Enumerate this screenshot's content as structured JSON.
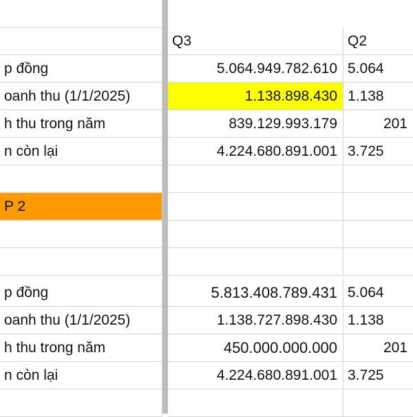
{
  "columns": {
    "col_b_header": "Q3",
    "col_c_header": "Q2"
  },
  "rows": [
    {
      "a": "",
      "b": "Q3",
      "c": "Q2"
    },
    {
      "a": "p đồng",
      "b": "5.064.949.782.610",
      "c": "5.064"
    },
    {
      "a": "oanh thu (1/1/2025)",
      "b": "1.138.898.430",
      "c": "1.138"
    },
    {
      "a": "h thu trong  năm",
      "b": "839.129.993.179",
      "c": "201"
    },
    {
      "a": "n còn lại",
      "b": "4.224.680.891.001",
      "c": "3.725"
    },
    {
      "a": "",
      "b": "",
      "c": ""
    },
    {
      "a": "P 2",
      "b": "",
      "c": ""
    },
    {
      "a": "",
      "b": "",
      "c": ""
    },
    {
      "a": "",
      "b": "",
      "c": ""
    },
    {
      "a": "p đồng",
      "b": "5.813.408.789.431",
      "c": "5.064"
    },
    {
      "a": "oanh thu (1/1/2025)",
      "b": "1.138.727.898.430",
      "c": "1.138"
    },
    {
      "a": "h thu trong  năm",
      "b": "450.000.000.000",
      "c": "201"
    },
    {
      "a": "n còn lại",
      "b": "4.224.680.891.001",
      "c": "3.725"
    },
    {
      "a": "",
      "b": "",
      "c": ""
    }
  ],
  "colors": {
    "highlight_yellow": "#ffff00",
    "highlight_orange": "#ff9900",
    "gridline": "#d4d4d4",
    "freeze_bar": "#bdbdbd"
  }
}
